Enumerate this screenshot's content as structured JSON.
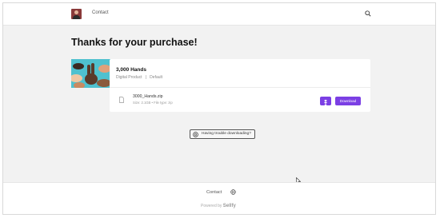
{
  "header": {
    "contact_label": "Contact"
  },
  "main": {
    "title": "Thanks for your purchase!",
    "product": {
      "title": "3,000 Hands",
      "type": "Digital Product",
      "separator": "|",
      "variant": "Default"
    },
    "file": {
      "name": "3000_Hands.zip",
      "meta": "Size: 2.1GB • File type: zip"
    },
    "download_label": "Download",
    "trouble_label": "Having trouble downloading?"
  },
  "footer": {
    "contact_label": "Contact",
    "powered_prefix": "Powered by",
    "brand": "Sellfy"
  },
  "colors": {
    "accent": "#7b3fe4",
    "thumbnail_bg": "#4fc1cf"
  }
}
